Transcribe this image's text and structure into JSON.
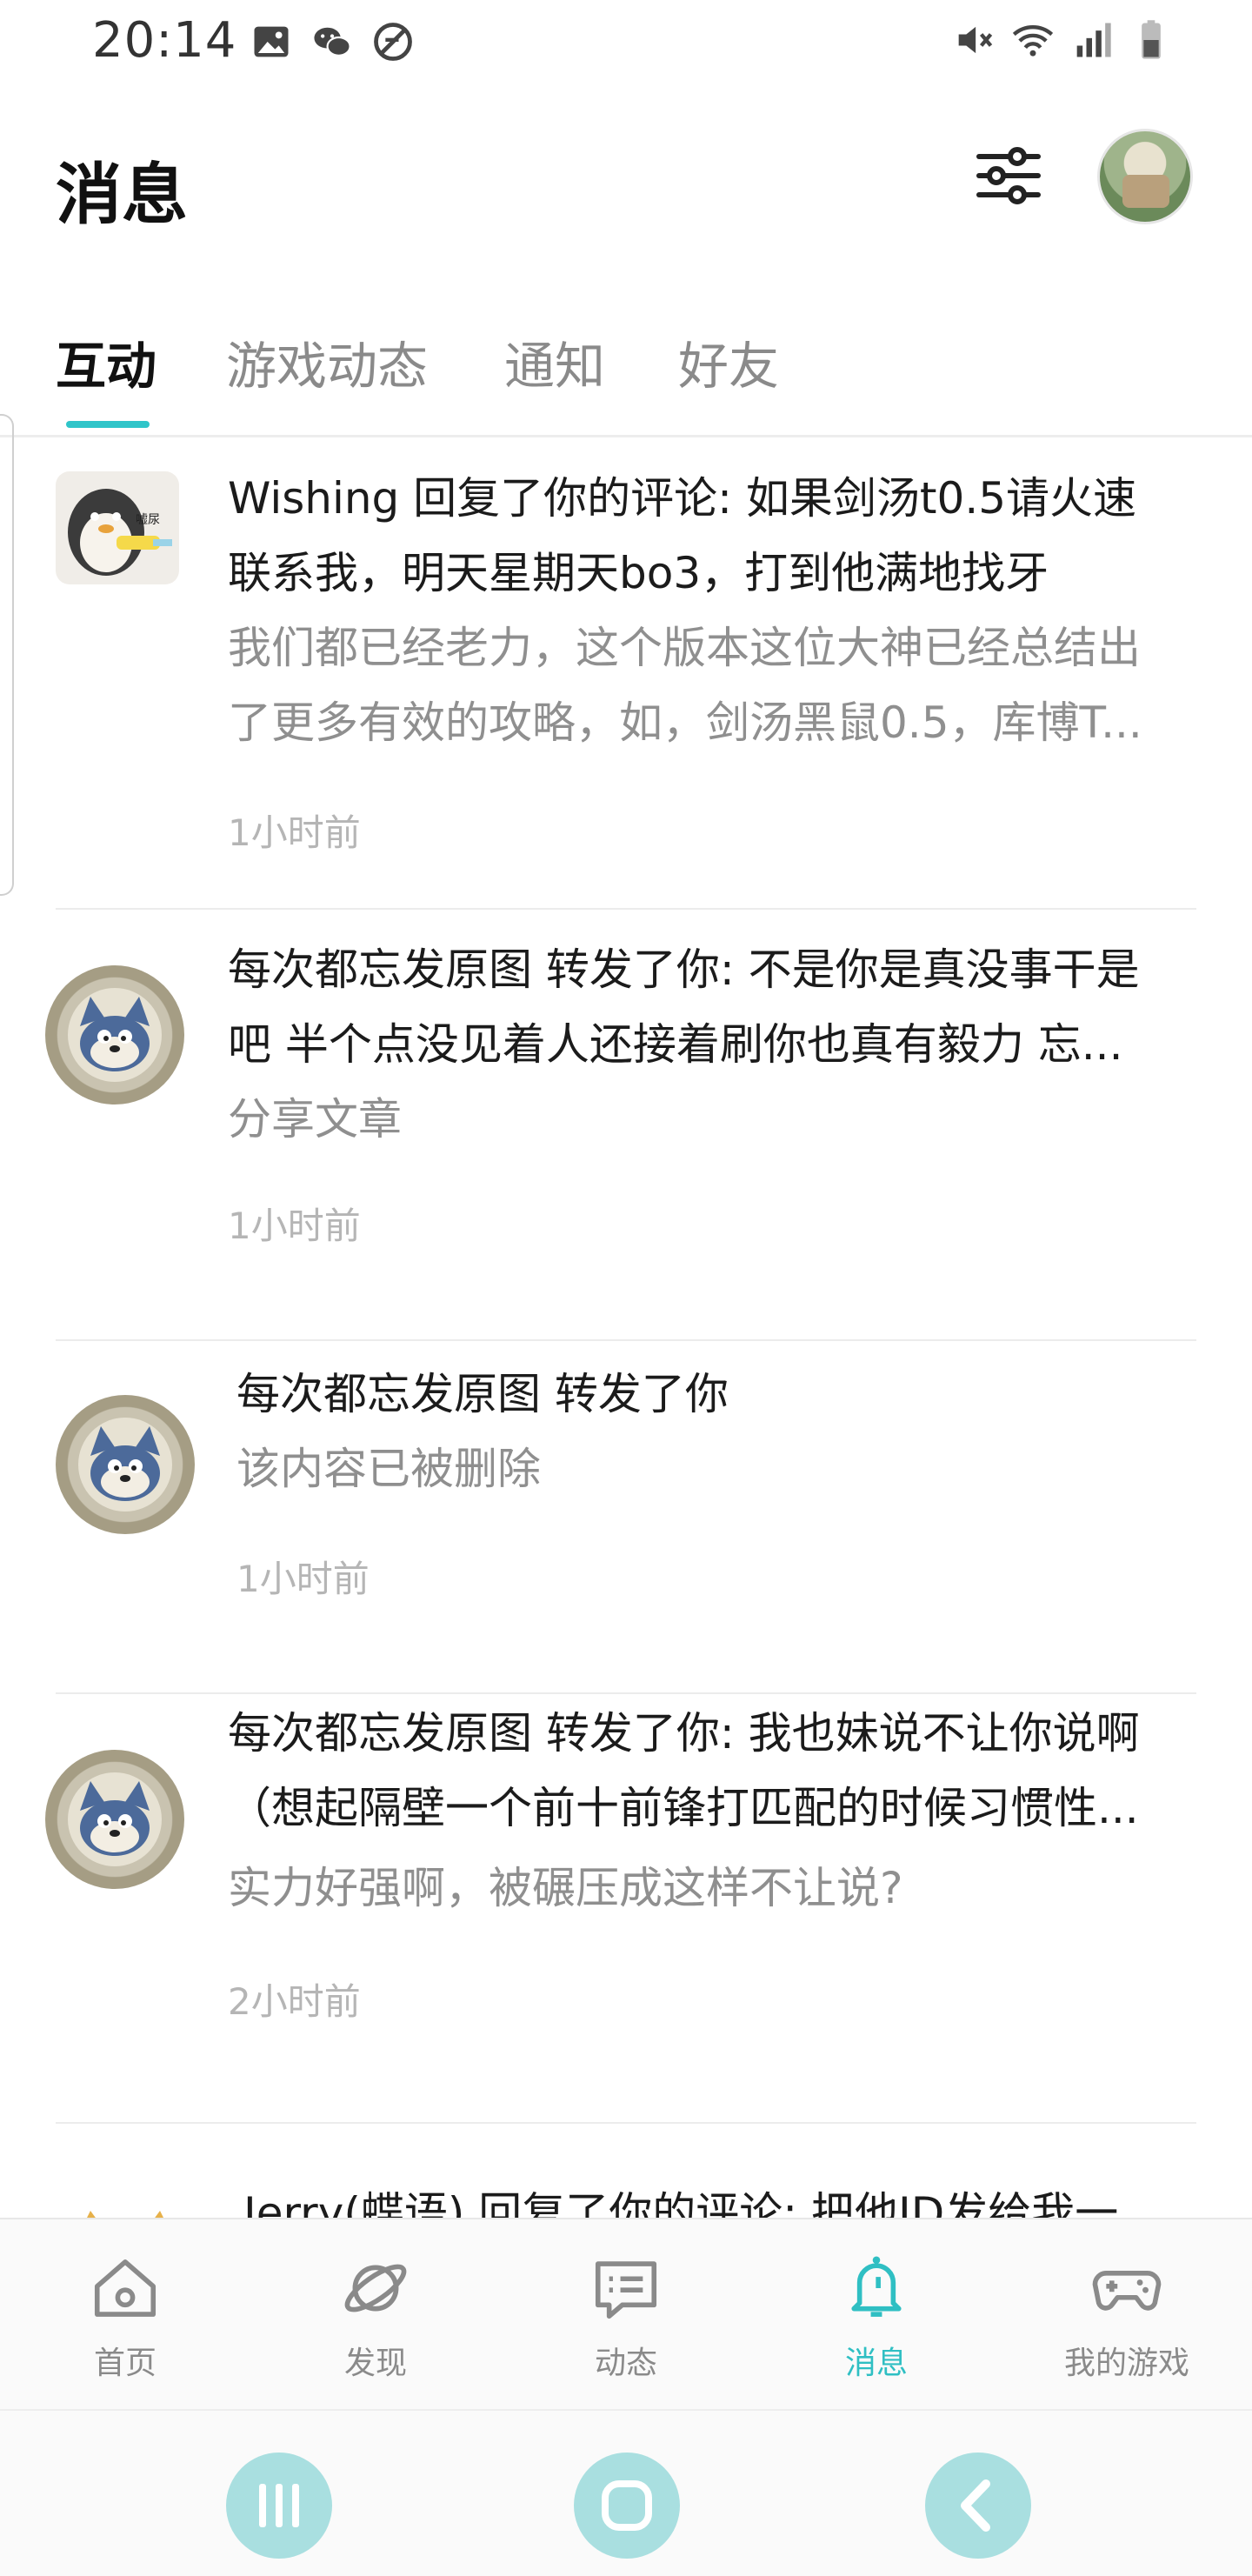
{
  "status_bar": {
    "time": "20:14",
    "left_icons": [
      "image-icon",
      "wechat-icon",
      "no-disturb-icon"
    ],
    "right_icons": [
      "mute-icon",
      "wifi-icon",
      "signal-icon",
      "battery-icon"
    ]
  },
  "header": {
    "title": "消息",
    "filter_icon": "sliders-icon"
  },
  "tabs": [
    {
      "label": "互动",
      "active": true
    },
    {
      "label": "游戏动态",
      "active": false
    },
    {
      "label": "通知",
      "active": false
    },
    {
      "label": "好友",
      "active": false
    }
  ],
  "messages": [
    {
      "main": [
        "Wishing 回复了你的评论: 如果剑汤t0.5请火速",
        "联系我，明天星期天bo3，打到他满地找牙"
      ],
      "sub": [
        "我们都已经老力，这个版本这位大神已经总结出",
        "了更多有效的攻略，如，剑汤黑鼠0.5，库博T..."
      ],
      "time": "1小时前",
      "avatar_text": "嘘尿"
    },
    {
      "main": [
        "每次都忘发原图 转发了你: 不是你是真没事干是",
        "吧 半个点没见着人还接着刷你也真有毅力 忘..."
      ],
      "sub": [
        "分享文章"
      ],
      "time": "1小时前"
    },
    {
      "main": [
        "每次都忘发原图 转发了你"
      ],
      "sub": [
        "该内容已被删除"
      ],
      "time": "1小时前"
    },
    {
      "main": [
        "每次都忘发原图 转发了你: 我也妹说不让你说啊",
        "（想起隔壁一个前十前锋打匹配的时候习惯性..."
      ],
      "sub": [
        "实力好强啊，被碾压成这样不让说?"
      ],
      "time": "2小时前"
    },
    {
      "main": [
        "Jerry(蝶语) 回复了你的评论: 把他ID发给我一"
      ],
      "sub": [],
      "time": ""
    }
  ],
  "bottom_nav": [
    {
      "label": "首页",
      "icon": "home-icon",
      "active": false
    },
    {
      "label": "发现",
      "icon": "planet-icon",
      "active": false
    },
    {
      "label": "动态",
      "icon": "feed-icon",
      "active": false
    },
    {
      "label": "消息",
      "icon": "bell-icon",
      "active": true
    },
    {
      "label": "我的游戏",
      "icon": "gamepad-icon",
      "active": false
    }
  ],
  "system_nav": [
    "recent-apps-icon",
    "home-circle-icon",
    "back-icon"
  ],
  "colors": {
    "accent": "#2fc5c9",
    "nav_active": "#2fbfc3",
    "system_button": "#a9dfe0"
  }
}
